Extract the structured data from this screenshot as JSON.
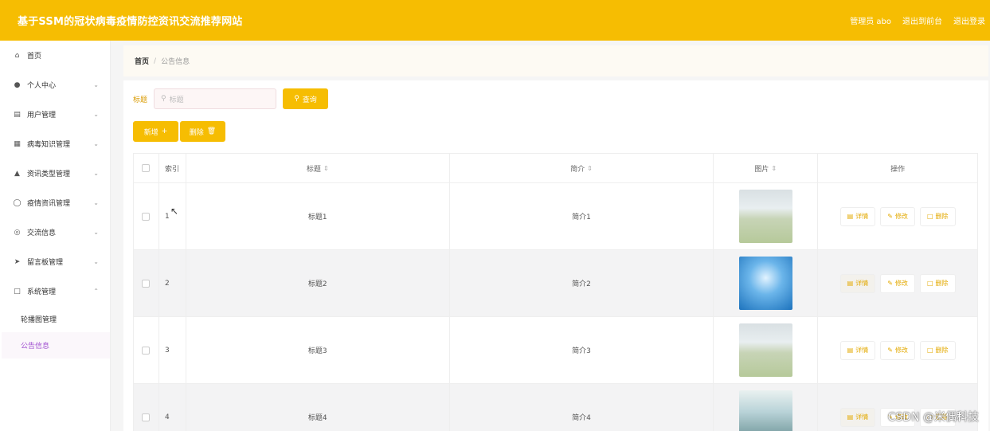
{
  "header": {
    "site_title": "基于SSM的冠状病毒疫情防控资讯交流推荐网站",
    "admin_label": "管理员 abo",
    "front_label": "退出到前台",
    "logout_label": "退出登录"
  },
  "sidebar": {
    "items": [
      {
        "label": "首页",
        "icon": "home-icon"
      },
      {
        "label": "个人中心",
        "icon": "user-icon"
      },
      {
        "label": "用户管理",
        "icon": "users-icon"
      },
      {
        "label": "病毒知识管理",
        "icon": "grid-icon"
      },
      {
        "label": "资讯类型管理",
        "icon": "like-icon"
      },
      {
        "label": "疫情资讯管理",
        "icon": "bulb-icon"
      },
      {
        "label": "交流信息",
        "icon": "globe-icon"
      },
      {
        "label": "留言板管理",
        "icon": "send-icon"
      },
      {
        "label": "系统管理",
        "icon": "chat-icon"
      }
    ],
    "sub_items": [
      {
        "label": "轮播图管理"
      },
      {
        "label": "公告信息"
      }
    ]
  },
  "breadcrumb": {
    "home": "首页",
    "sep": "/",
    "current": "公告信息"
  },
  "search": {
    "label": "标题",
    "placeholder": "标题",
    "button": "查询"
  },
  "actions": {
    "add": "新增",
    "delete": "删除"
  },
  "table": {
    "headers": {
      "index": "索引",
      "title": "标题",
      "intro": "简介",
      "picture": "图片",
      "ops": "操作"
    },
    "rows": [
      {
        "index": "1",
        "title": "标题1",
        "intro": "简介1"
      },
      {
        "index": "2",
        "title": "标题2",
        "intro": "简介2"
      },
      {
        "index": "3",
        "title": "标题3",
        "intro": "简介3"
      },
      {
        "index": "4",
        "title": "标题4",
        "intro": "简介4"
      }
    ],
    "op_labels": {
      "detail": "详情",
      "edit": "修改",
      "delete": "删除"
    }
  },
  "watermark": "CSDN @米偶科技",
  "colors": {
    "accent": "#f6bd02",
    "active_sub": "#a050d0"
  }
}
